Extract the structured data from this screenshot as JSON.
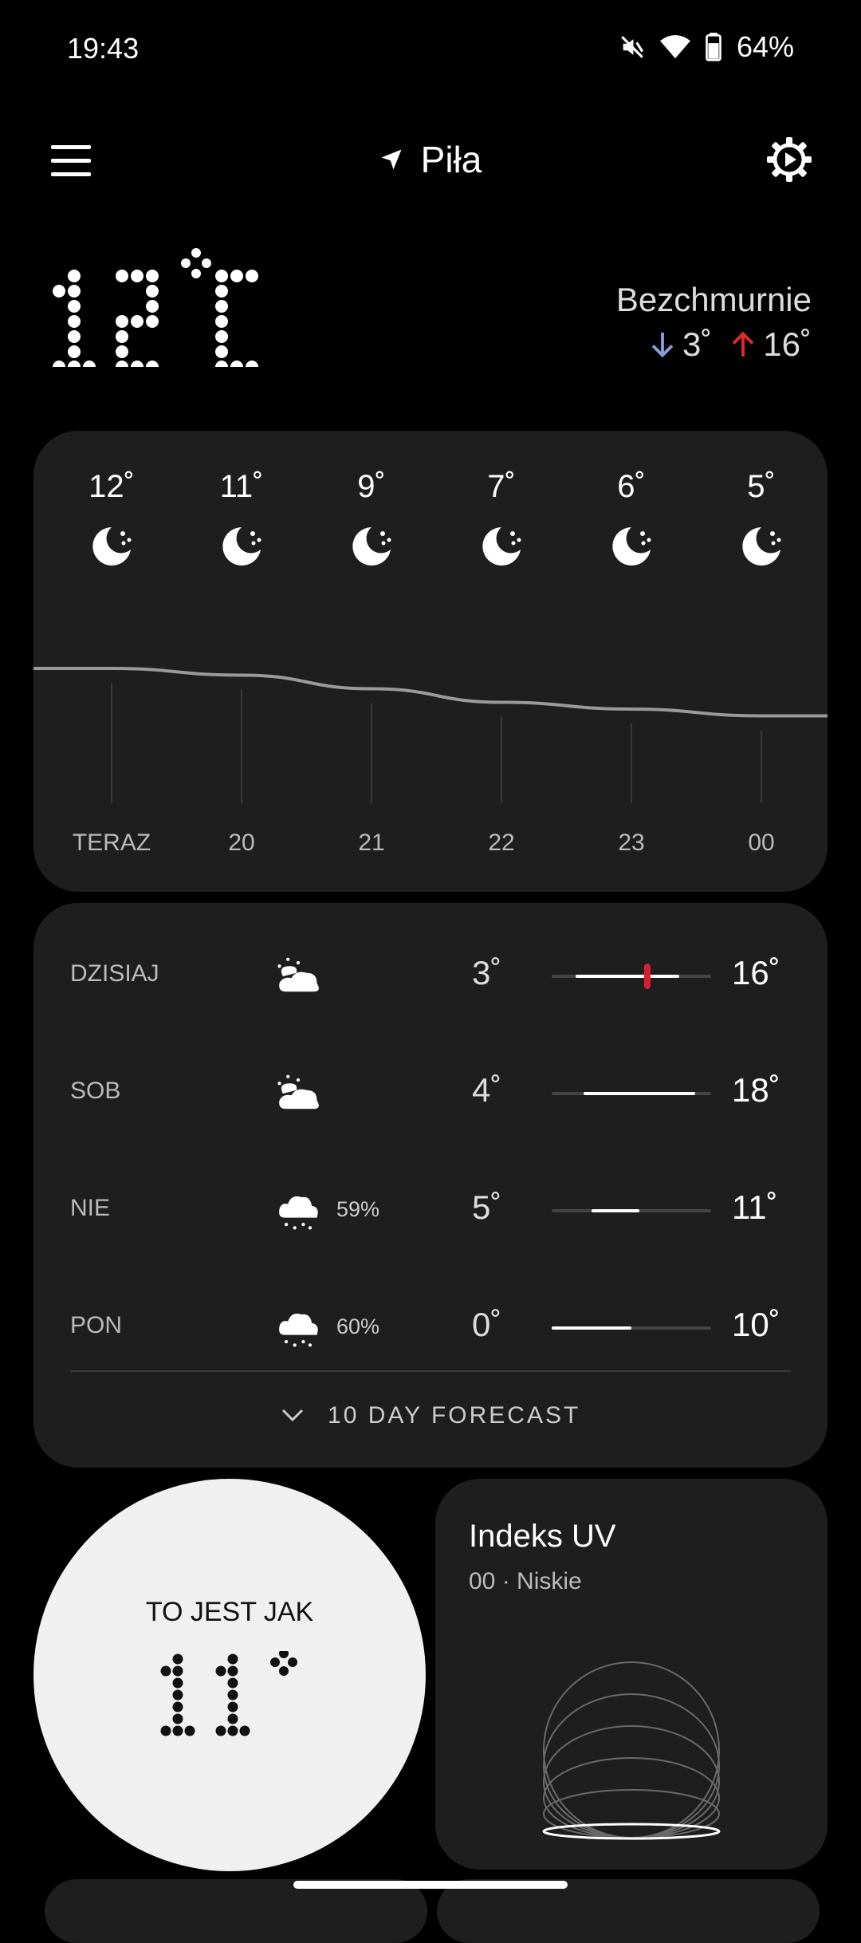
{
  "status_bar": {
    "time": "19:43",
    "battery": "64%",
    "icons": [
      "mute-icon",
      "wifi-icon",
      "battery-icon"
    ]
  },
  "header": {
    "location": "Piła",
    "icons": [
      "menu-icon",
      "location-arrow-icon",
      "settings-icon"
    ]
  },
  "current": {
    "temp_number": "12",
    "temp_unit": "°C",
    "condition": "Bezchmurnie",
    "low": "3˚",
    "high": "16˚"
  },
  "hourly": [
    {
      "temp": "12˚",
      "label": "TERAZ",
      "icon": "moon-icon",
      "value": 12
    },
    {
      "temp": "11˚",
      "label": "20",
      "icon": "moon-icon",
      "value": 11
    },
    {
      "temp": "9˚",
      "label": "21",
      "icon": "moon-icon",
      "value": 9
    },
    {
      "temp": "7˚",
      "label": "22",
      "icon": "moon-icon",
      "value": 7
    },
    {
      "temp": "6˚",
      "label": "23",
      "icon": "moon-icon",
      "value": 6
    },
    {
      "temp": "5˚",
      "label": "00",
      "icon": "moon-icon",
      "value": 5
    }
  ],
  "daily": [
    {
      "day": "DZISIAJ",
      "icon": "sun-cloud-icon",
      "precip": "",
      "low": "3˚",
      "high": "16˚",
      "low_v": 3,
      "high_v": 16
    },
    {
      "day": "SOB",
      "icon": "sun-cloud-icon",
      "precip": "",
      "low": "4˚",
      "high": "18˚",
      "low_v": 4,
      "high_v": 18
    },
    {
      "day": "NIE",
      "icon": "rain-cloud-icon",
      "precip": "59%",
      "low": "5˚",
      "high": "11˚",
      "low_v": 5,
      "high_v": 11
    },
    {
      "day": "PON",
      "icon": "rain-cloud-icon",
      "precip": "60%",
      "low": "0˚",
      "high": "10˚",
      "low_v": 0,
      "high_v": 10
    }
  ],
  "daily_range": {
    "min": 0,
    "max": 20,
    "current": 12
  },
  "forecast_button": "10 DAY FORECAST",
  "feels_like": {
    "title": "TO JEST JAK",
    "value": "11"
  },
  "uv": {
    "title": "Indeks UV",
    "subtitle": "00 · Niskie"
  },
  "colors": {
    "background": "#000000",
    "card": "#1e1e1e",
    "low_arrow": "#8a9bd6",
    "high_arrow": "#e02b2b",
    "current_marker": "#d42030"
  }
}
